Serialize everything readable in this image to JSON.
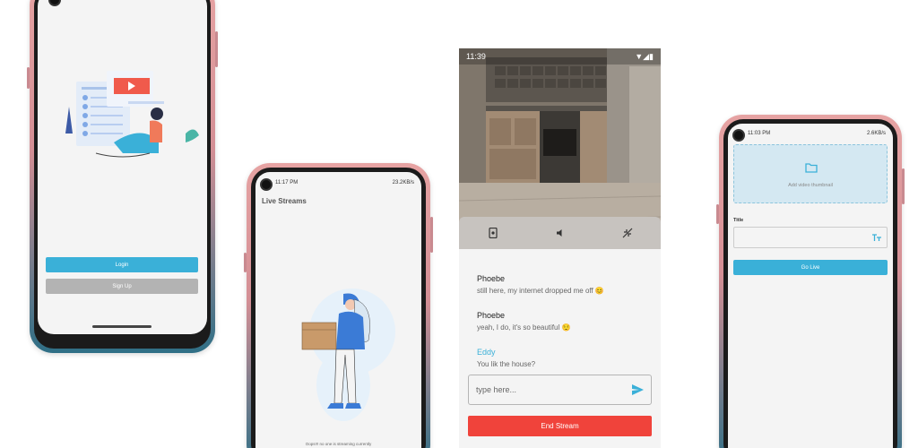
{
  "phone1": {
    "login_label": "Login",
    "signup_label": "Sign Up"
  },
  "phone2": {
    "status_time": "11:17 PM",
    "status_right": "23.2KB/s",
    "title": "Live Streams",
    "empty_text": "Oops!!! no one is streaming currently"
  },
  "phone3": {
    "status_time": "11:39",
    "messages": [
      {
        "name": "Phoebe",
        "text": "still here, my internet dropped me off 😊",
        "name_color": "#222222"
      },
      {
        "name": "Phoebe",
        "text": "yeah, I do, it's so beautiful 😌",
        "name_color": "#222222"
      },
      {
        "name": "Eddy",
        "text": "You lik the house?",
        "name_color": "#3ab0d8"
      }
    ],
    "input_placeholder": "type here...",
    "end_stream_label": "End Stream"
  },
  "phone4": {
    "status_time": "11:03 PM",
    "status_right": "2.6KB/s",
    "thumbnail_label": "Add video thumbnail",
    "title_label": "Title",
    "title_value": "",
    "go_live_label": "Go Live"
  },
  "colors": {
    "accent_blue": "#3ab0d8",
    "signup_gray": "#b3b3b3",
    "end_red": "#f0433b"
  }
}
